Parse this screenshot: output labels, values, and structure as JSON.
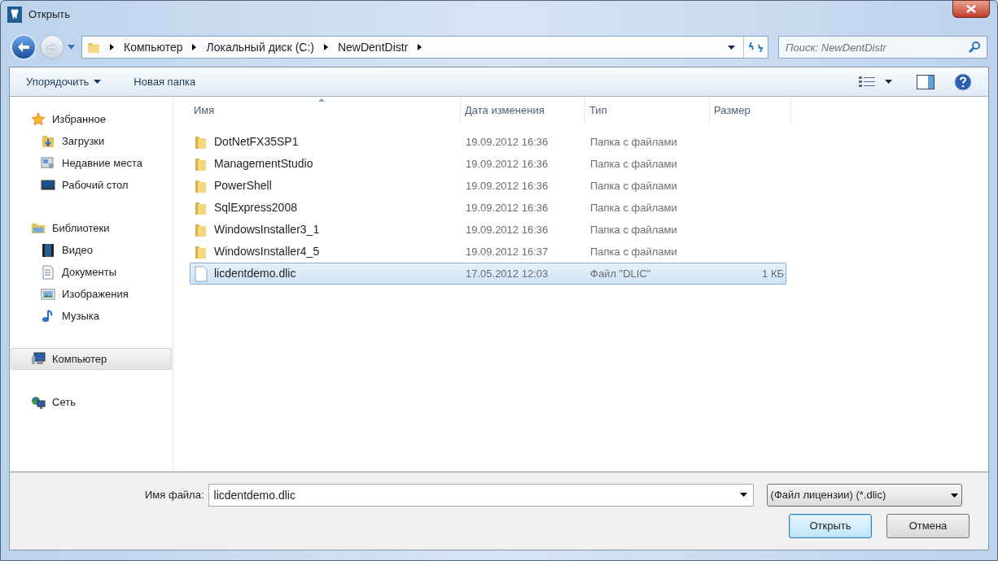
{
  "window": {
    "title": "Открыть"
  },
  "breadcrumb": [
    "Компьютер",
    "Локальный диск (C:)",
    "NewDentDistr"
  ],
  "search": {
    "placeholder": "Поиск: NewDentDistr"
  },
  "toolbar": {
    "organize": "Упорядочить",
    "new_folder": "Новая папка"
  },
  "sidebar": {
    "groups": [
      {
        "label": "Избранное",
        "selected": false,
        "children": [
          {
            "label": "Загрузки",
            "selected": false
          },
          {
            "label": "Недавние места",
            "selected": false
          },
          {
            "label": "Рабочий стол",
            "selected": false
          }
        ]
      },
      {
        "label": "Библиотеки",
        "selected": false,
        "children": [
          {
            "label": "Видео",
            "selected": false
          },
          {
            "label": "Документы",
            "selected": false
          },
          {
            "label": "Изображения",
            "selected": false
          },
          {
            "label": "Музыка",
            "selected": false
          }
        ]
      },
      {
        "label": "Компьютер",
        "selected": true
      },
      {
        "label": "Сеть",
        "selected": false
      }
    ]
  },
  "table": {
    "columns": [
      "Имя",
      "Дата изменения",
      "Тип",
      "Размер"
    ],
    "rows": [
      {
        "kind": "folder",
        "name": "DotNetFX35SP1",
        "date": "19.09.2012 16:36",
        "type": "Папка с файлами",
        "size": "",
        "selected": false
      },
      {
        "kind": "folder",
        "name": "ManagementStudio",
        "date": "19.09.2012 16:36",
        "type": "Папка с файлами",
        "size": "",
        "selected": false
      },
      {
        "kind": "folder",
        "name": "PowerShell",
        "date": "19.09.2012 16:36",
        "type": "Папка с файлами",
        "size": "",
        "selected": false
      },
      {
        "kind": "folder",
        "name": "SqlExpress2008",
        "date": "19.09.2012 16:36",
        "type": "Папка с файлами",
        "size": "",
        "selected": false
      },
      {
        "kind": "folder",
        "name": "WindowsInstaller3_1",
        "date": "19.09.2012 16:36",
        "type": "Папка с файлами",
        "size": "",
        "selected": false
      },
      {
        "kind": "folder",
        "name": "WindowsInstaller4_5",
        "date": "19.09.2012 16:37",
        "type": "Папка с файлами",
        "size": "",
        "selected": false
      },
      {
        "kind": "file",
        "name": "licdentdemo.dlic",
        "date": "17.05.2012 12:03",
        "type": "Файл \"DLIC\"",
        "size": "1 КБ",
        "selected": true
      }
    ]
  },
  "footer": {
    "filename_label": "Имя файла:",
    "filename": "licdentdemo.dlic",
    "filter": "(Файл лицензии) (*.dlic)",
    "open": "Открыть",
    "cancel": "Отмена"
  }
}
